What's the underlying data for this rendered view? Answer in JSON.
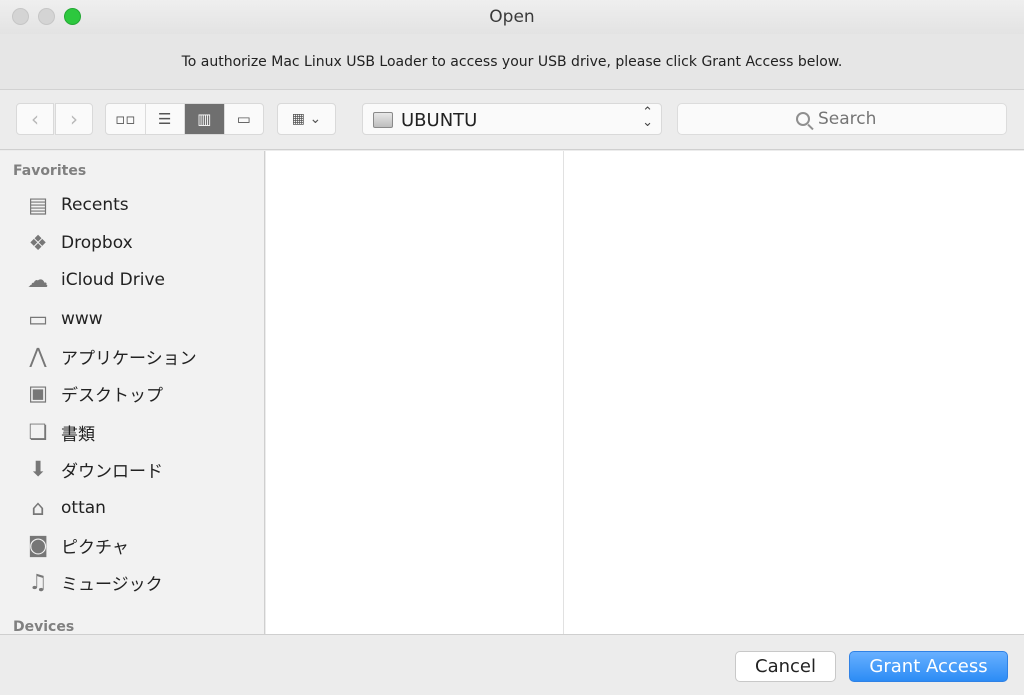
{
  "window": {
    "title": "Open"
  },
  "banner": {
    "message": "To authorize Mac Linux USB Loader to access your USB drive, please click Grant Access below."
  },
  "toolbar": {
    "back_glyph": "‹",
    "forward_glyph": "›",
    "view_modes": [
      {
        "icon": "icon-view-icon",
        "glyph": "▫▫",
        "active": false
      },
      {
        "icon": "list-view-icon",
        "glyph": "☰",
        "active": false
      },
      {
        "icon": "column-view-icon",
        "glyph": "▥",
        "active": true
      },
      {
        "icon": "cover-flow-icon",
        "glyph": "▭",
        "active": false
      }
    ],
    "arrange_glyph": "▦ ⌄",
    "location": "UBUNTU",
    "search_placeholder": "Search"
  },
  "sidebar": {
    "favorites_heading": "Favorites",
    "items": [
      {
        "label": "Recents",
        "icon": "recents-icon",
        "glyph": "▤"
      },
      {
        "label": "Dropbox",
        "icon": "dropbox-icon",
        "glyph": "❖"
      },
      {
        "label": "iCloud Drive",
        "icon": "icloud-icon",
        "glyph": "☁"
      },
      {
        "label": "www",
        "icon": "folder-icon",
        "glyph": "▭"
      },
      {
        "label": "アプリケーション",
        "icon": "applications-icon",
        "glyph": "⋀"
      },
      {
        "label": "デスクトップ",
        "icon": "desktop-icon",
        "glyph": "▣"
      },
      {
        "label": "書類",
        "icon": "documents-icon",
        "glyph": "❏"
      },
      {
        "label": "ダウンロード",
        "icon": "downloads-icon",
        "glyph": "⬇"
      },
      {
        "label": "ottan",
        "icon": "home-icon",
        "glyph": "⌂"
      },
      {
        "label": "ピクチャ",
        "icon": "camera-icon",
        "glyph": "◙"
      },
      {
        "label": "ミュージック",
        "icon": "music-icon",
        "glyph": "♫"
      }
    ],
    "devices_heading": "Devices"
  },
  "buttons": {
    "cancel": "Cancel",
    "grant": "Grant Access"
  }
}
